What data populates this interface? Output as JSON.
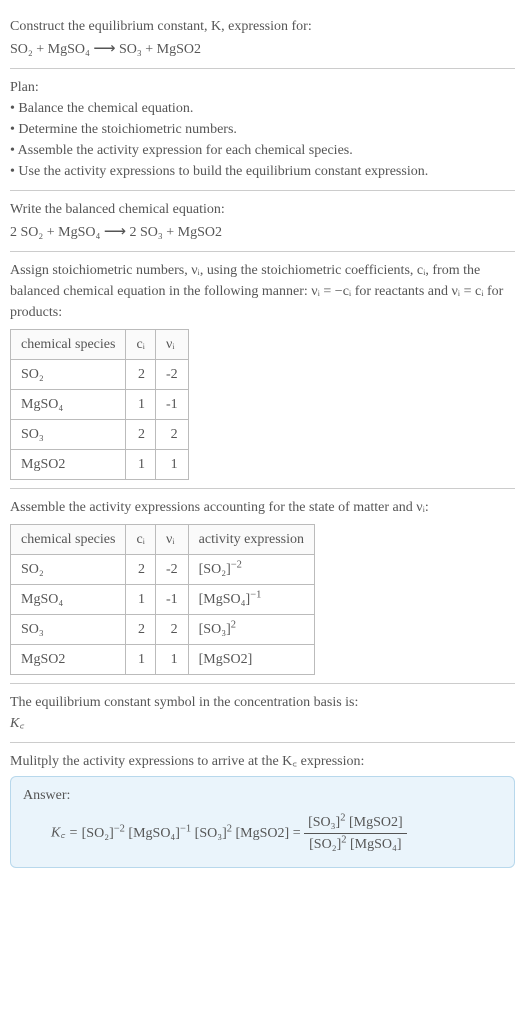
{
  "intro": {
    "line1": "Construct the equilibrium constant, K, expression for:",
    "eq_lhs": "SO₂ + MgSO₄",
    "eq_arrow": "⟶",
    "eq_rhs": "SO₃ + MgSO2"
  },
  "plan": {
    "heading": "Plan:",
    "bullets": [
      "• Balance the chemical equation.",
      "• Determine the stoichiometric numbers.",
      "• Assemble the activity expression for each chemical species.",
      "• Use the activity expressions to build the equilibrium constant expression."
    ]
  },
  "balanced": {
    "text": "Write the balanced chemical equation:",
    "eq_lhs": "2 SO₂ + MgSO₄",
    "eq_arrow": "⟶",
    "eq_rhs": "2 SO₃ + MgSO2"
  },
  "assign": {
    "text_a": "Assign stoichiometric numbers, νᵢ, using the stoichiometric coefficients, cᵢ, from the balanced chemical equation in the following manner: νᵢ = −cᵢ for reactants and νᵢ = cᵢ for products:",
    "headers": [
      "chemical species",
      "cᵢ",
      "νᵢ"
    ],
    "rows": [
      {
        "sp": "SO₂",
        "c": "2",
        "v": "-2"
      },
      {
        "sp": "MgSO₄",
        "c": "1",
        "v": "-1"
      },
      {
        "sp": "SO₃",
        "c": "2",
        "v": "2"
      },
      {
        "sp": "MgSO2",
        "c": "1",
        "v": "1"
      }
    ]
  },
  "activity": {
    "text": "Assemble the activity expressions accounting for the state of matter and νᵢ:",
    "headers": [
      "chemical species",
      "cᵢ",
      "νᵢ",
      "activity expression"
    ],
    "rows": [
      {
        "sp": "SO₂",
        "c": "2",
        "v": "-2",
        "a_base": "[SO₂]",
        "a_exp": "−2"
      },
      {
        "sp": "MgSO₄",
        "c": "1",
        "v": "-1",
        "a_base": "[MgSO₄]",
        "a_exp": "−1"
      },
      {
        "sp": "SO₃",
        "c": "2",
        "v": "2",
        "a_base": "[SO₃]",
        "a_exp": "2"
      },
      {
        "sp": "MgSO2",
        "c": "1",
        "v": "1",
        "a_base": "[MgSO2]",
        "a_exp": ""
      }
    ]
  },
  "kc_symbol": {
    "text": "The equilibrium constant symbol in the concentration basis is:",
    "sym": "K꜀"
  },
  "multiply": {
    "text": "Mulitply the activity expressions to arrive at the K꜀ expression:"
  },
  "answer": {
    "label": "Answer:",
    "lhs": "K꜀ = ",
    "p1_base": "[SO₂]",
    "p1_exp": "−2",
    "p2_base": "[MgSO₄]",
    "p2_exp": "−1",
    "p3_base": "[SO₃]",
    "p3_exp": "2",
    "p4_base": "[MgSO2]",
    "p4_exp": "",
    "eq_sign": " = ",
    "num1_base": "[SO₃]",
    "num1_exp": "2",
    "num2_base": "[MgSO2]",
    "num2_exp": "",
    "den1_base": "[SO₂]",
    "den1_exp": "2",
    "den2_base": "[MgSO₄]",
    "den2_exp": ""
  }
}
